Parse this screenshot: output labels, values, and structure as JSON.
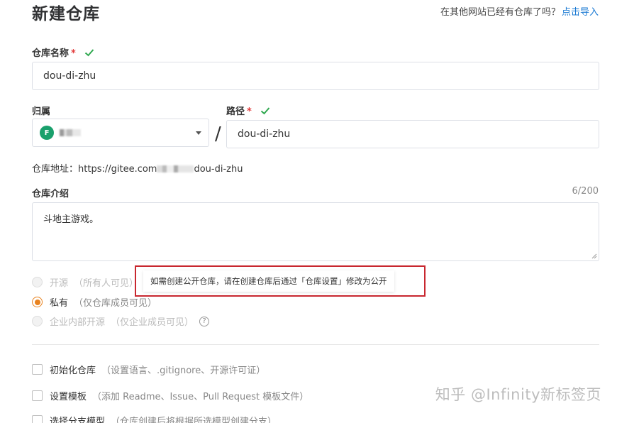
{
  "header": {
    "title": "新建仓库",
    "import_hint": "在其他网站已经有仓库了吗？",
    "import_link": "点击导入"
  },
  "repo_name": {
    "label": "仓库名称",
    "required_mark": "*",
    "value": "dou-di-zhu"
  },
  "owner": {
    "label": "归属",
    "avatar_letter": "F"
  },
  "path": {
    "label": "路径",
    "required_mark": "*",
    "separator": "/",
    "value": "dou-di-zhu"
  },
  "repo_url": {
    "label": "仓库地址：",
    "prefix": "https://gitee.com",
    "suffix": "dou-di-zhu"
  },
  "description": {
    "label": "仓库介绍",
    "counter": "6/200",
    "value": "斗地主游戏。"
  },
  "visibility": {
    "options": [
      {
        "label": "开源",
        "hint": "（所有人可见）",
        "selected": false,
        "disabled": true
      },
      {
        "label": "私有",
        "hint": "（仅仓库成员可见）",
        "selected": true,
        "disabled": false
      },
      {
        "label": "企业内部开源",
        "hint": "（仅企业成员可见）",
        "selected": false,
        "disabled": true
      }
    ],
    "help_glyph": "?",
    "tooltip": "如需创建公开仓库，请在创建仓库后通过「仓库设置」修改为公开"
  },
  "options": [
    {
      "label": "初始化仓库",
      "hint": "（设置语言、.gitignore、开源许可证）"
    },
    {
      "label": "设置模板",
      "hint": "（添加 Readme、Issue、Pull Request 模板文件）"
    },
    {
      "label": "选择分支模型",
      "hint": "（仓库创建后将根据所选模型创建分支）"
    }
  ],
  "watermark": "知乎 @Infinity新标签页",
  "colors": {
    "accent": "#e8821e",
    "link": "#1677d2",
    "check": "#2fa84f",
    "required": "#e23c3c",
    "highlight_border": "#c8272f"
  }
}
